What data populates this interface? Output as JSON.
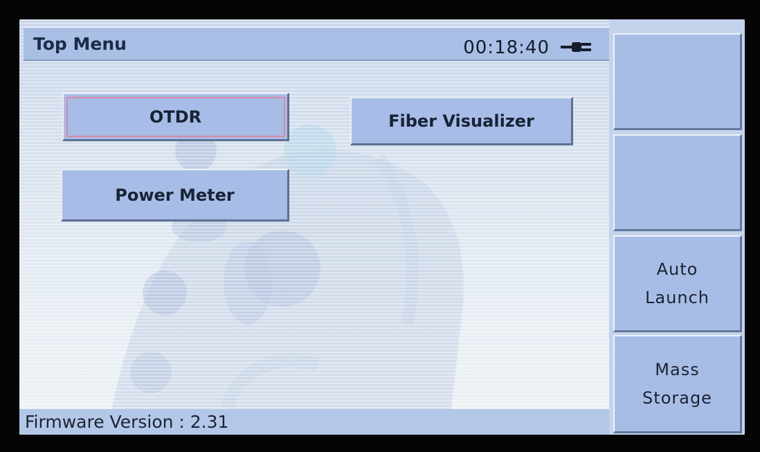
{
  "header": {
    "title": "Top Menu",
    "clock": "00:18:40",
    "power_icon": "ac-plug-icon"
  },
  "menu": {
    "buttons": [
      {
        "label": "OTDR",
        "selected": true
      },
      {
        "label": "Fiber Visualizer",
        "selected": false
      },
      {
        "label": "Power Meter",
        "selected": false
      }
    ]
  },
  "softkeys": [
    {
      "line1": "",
      "line2": ""
    },
    {
      "line1": "",
      "line2": ""
    },
    {
      "line1": "Auto",
      "line2": "Launch"
    },
    {
      "line1": "Mass",
      "line2": "Storage"
    }
  ],
  "status": {
    "firmware_label": "Firmware Version :",
    "firmware_version": "2.31"
  },
  "colors": {
    "bar": "#a9bfe6",
    "button": "#a7bce6",
    "selection_outline": "#d88aa3",
    "background": "#dfe7ef"
  }
}
